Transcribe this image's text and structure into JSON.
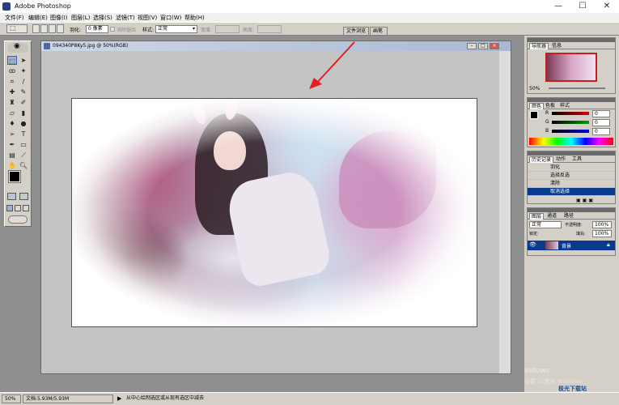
{
  "window": {
    "title": "Adobe Photoshop",
    "minimize": "—",
    "maximize": "☐",
    "close": "✕"
  },
  "menu": [
    "文件(F)",
    "编辑(E)",
    "图像(I)",
    "图层(L)",
    "选择(S)",
    "滤镜(T)",
    "视图(V)",
    "窗口(W)",
    "帮助(H)"
  ],
  "options": {
    "feather_label": "羽化:",
    "feather_value": "0 像素",
    "antialias_label": "消除锯齿",
    "style_label": "样式:",
    "style_value": "正常",
    "width_label": "宽度:",
    "height_label": "高度:",
    "well_tabs": [
      "文件浏览",
      "画笔"
    ]
  },
  "document": {
    "title": "094340P8Ky5.jpg @ 50%(RGB)"
  },
  "navigator": {
    "tabs": [
      "导航器",
      "信息"
    ],
    "zoom": "50%"
  },
  "color": {
    "tabs": [
      "颜色",
      "色板",
      "样式"
    ],
    "channels": [
      {
        "label": "R",
        "value": "0",
        "color": "#e00000"
      },
      {
        "label": "G",
        "value": "0",
        "color": "#00a000"
      },
      {
        "label": "B",
        "value": "0",
        "color": "#0000e0"
      }
    ]
  },
  "history": {
    "tabs": [
      "历史记录",
      "动作",
      "工具"
    ],
    "items": [
      "羽化",
      "选择反选",
      "清除",
      "取消选择"
    ],
    "selected_index": 3
  },
  "layers": {
    "tabs": [
      "图层",
      "通道",
      "路径"
    ],
    "blend_mode": "正常",
    "opacity_label": "不透明度:",
    "opacity_value": "100%",
    "lock_label": "锁定:",
    "fill_label": "填充:",
    "fill_value": "100%",
    "layer_name": "背景"
  },
  "status": {
    "zoom": "50%",
    "doc_size": "文档:5.93M/5.93M",
    "hint": "从中心绘制选区或从现有选区中减去"
  },
  "watermark": {
    "line1": "indows",
    "line2": "设置\"以激活 Windows",
    "site": "极光下载站"
  },
  "colors": {
    "accent_red": "#e02020",
    "selection_blue": "#0a3a8e"
  }
}
